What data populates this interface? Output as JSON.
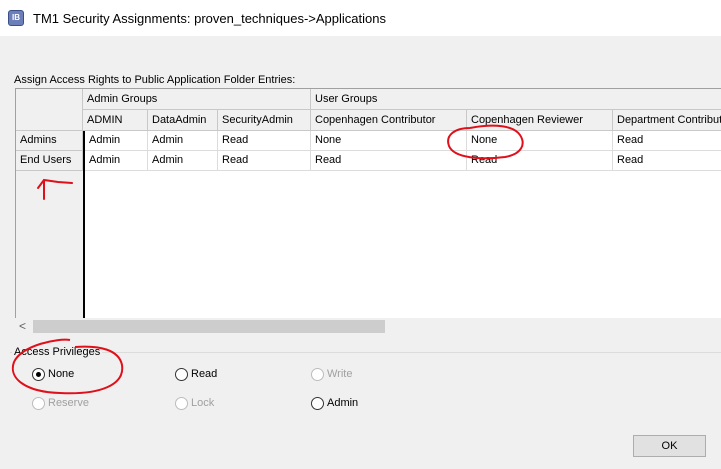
{
  "window": {
    "title": "TM1 Security Assignments:  proven_techniques->Applications",
    "icon": "tm1-app-icon"
  },
  "section_label": "Assign Access Rights to Public Application Folder Entries:",
  "grid": {
    "group_headers": [
      "Admin Groups",
      "User Groups"
    ],
    "columns": [
      "ADMIN",
      "DataAdmin",
      "SecurityAdmin",
      "Copenhagen Contributor",
      "Copenhagen Reviewer",
      "Department Contribut"
    ],
    "rows": [
      {
        "name": "Admins",
        "cells": [
          "Admin",
          "Admin",
          "Read",
          "None",
          "None",
          "Read"
        ]
      },
      {
        "name": "End Users",
        "cells": [
          "Admin",
          "Admin",
          "Read",
          "Read",
          "Read",
          "Read"
        ]
      }
    ]
  },
  "scrollbar": {
    "left_arrow": "<"
  },
  "privileges": {
    "title": "Access Privileges",
    "options": [
      {
        "label": "None",
        "checked": true,
        "enabled": true
      },
      {
        "label": "Read",
        "checked": false,
        "enabled": true
      },
      {
        "label": "Write",
        "checked": false,
        "enabled": false
      },
      {
        "label": "Reserve",
        "checked": false,
        "enabled": false
      },
      {
        "label": "Lock",
        "checked": false,
        "enabled": false
      },
      {
        "label": "Admin",
        "checked": false,
        "enabled": true
      }
    ]
  },
  "ok_label": "OK",
  "annotation_color": "#e0101a"
}
